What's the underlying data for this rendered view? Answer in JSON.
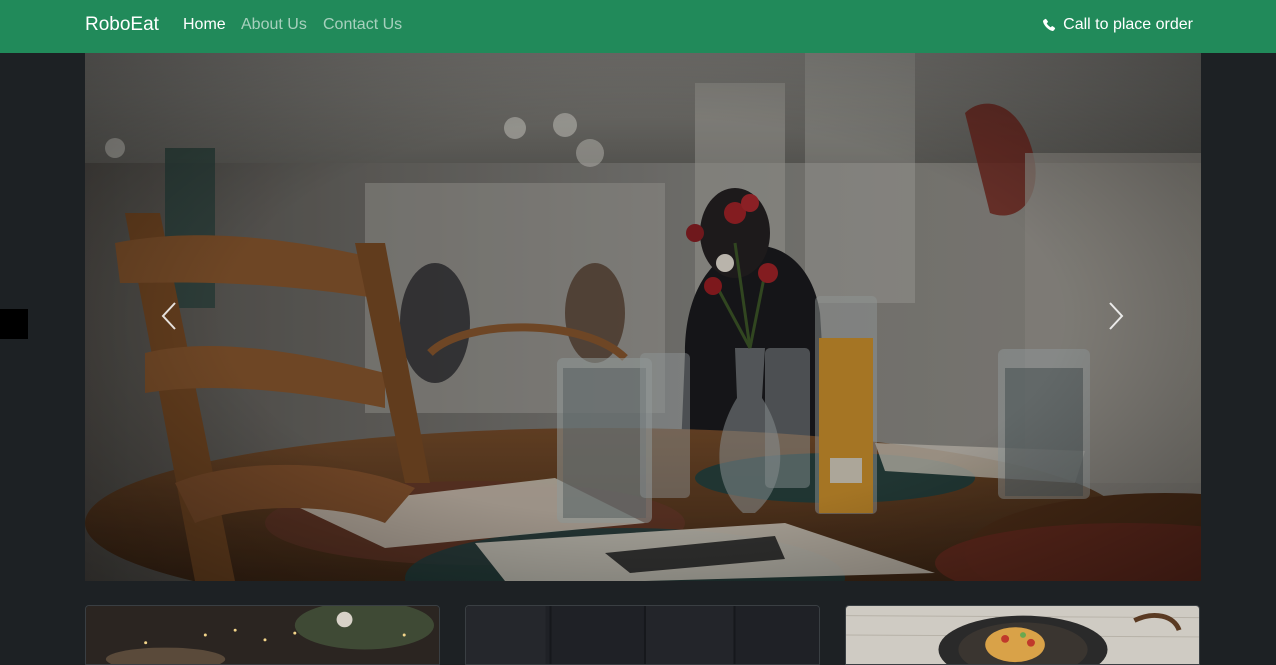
{
  "navbar": {
    "brand": "RoboEat",
    "links": [
      {
        "label": "Home",
        "active": true
      },
      {
        "label": "About Us",
        "active": false
      },
      {
        "label": "Contact Us",
        "active": false
      }
    ],
    "call_label": "Call to place order",
    "call_icon": "phone-icon",
    "bg_color": "#218a5a"
  },
  "carousel": {
    "image": "restaurant-table-photo",
    "prev_icon": "chevron-left-icon",
    "next_icon": "chevron-right-icon"
  },
  "cards": [
    {
      "image": "festive-food-photo"
    },
    {
      "image": "dark-wood-photo"
    },
    {
      "image": "food-plate-photo"
    }
  ],
  "page_bg": "#1d2124"
}
